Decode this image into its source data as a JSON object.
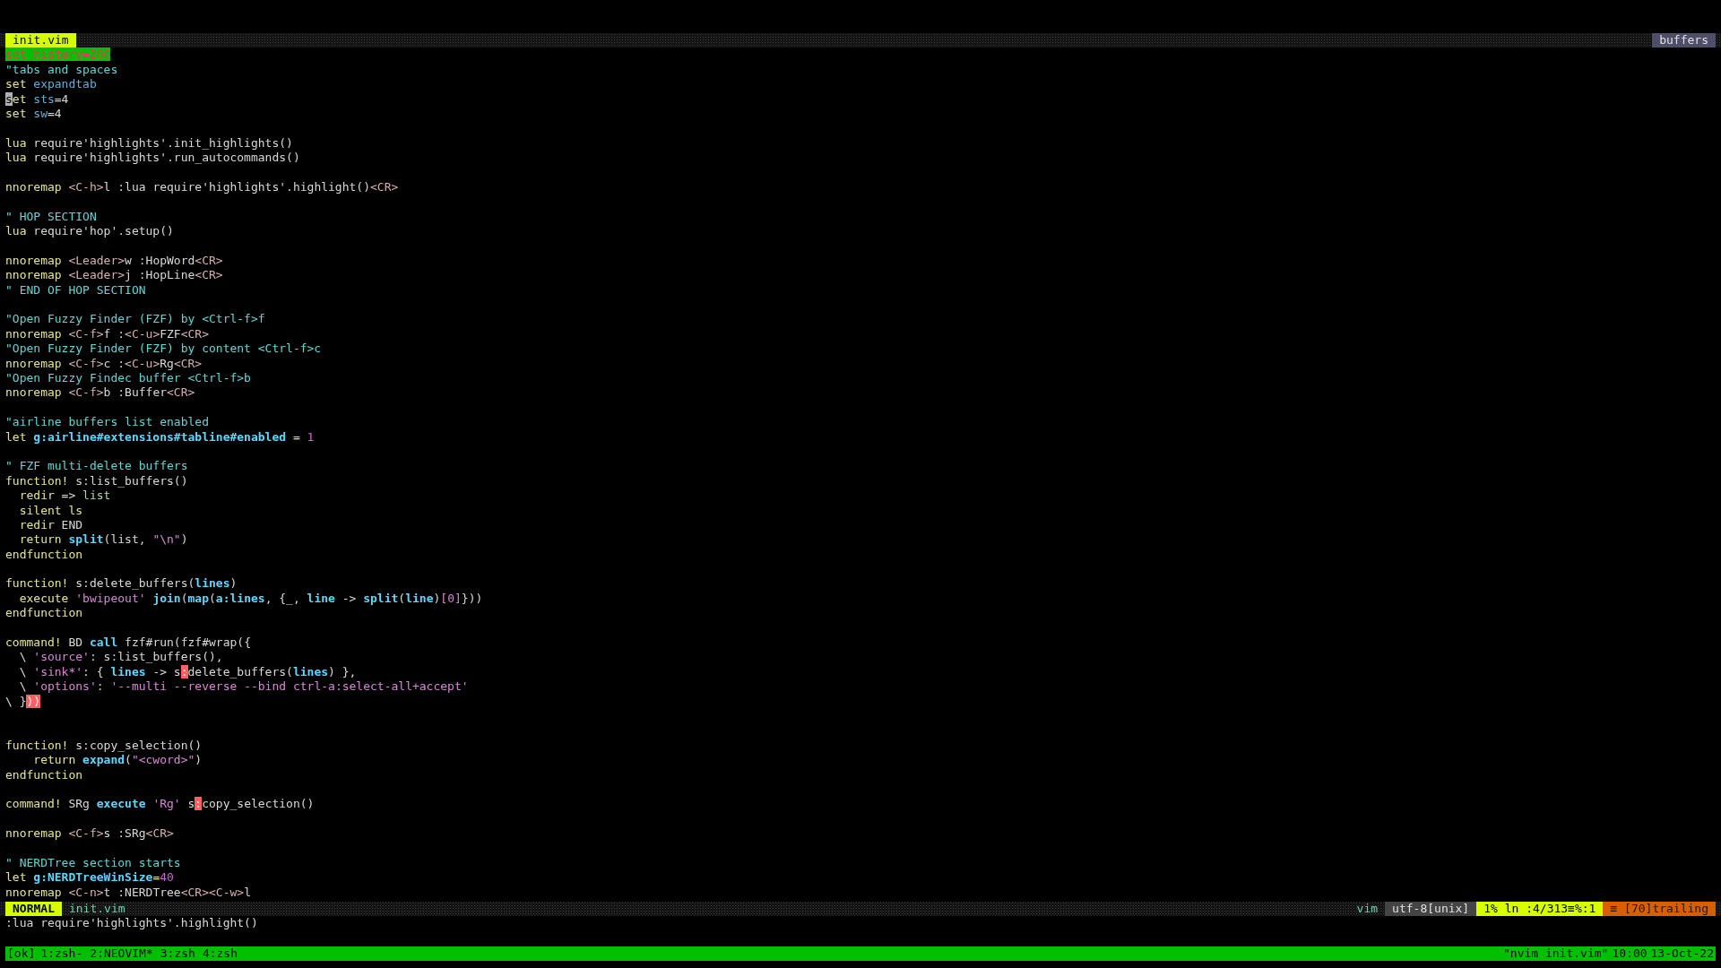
{
  "tabline": {
    "buffer": "init.vim",
    "label": "buffers"
  },
  "lines": [
    {
      "kind": "code",
      "segments": [
        {
          "kind": "hl",
          "text": "set history=200"
        }
      ]
    },
    {
      "kind": "code",
      "segments": [
        {
          "kind": "comment",
          "text": "\"tabs and spaces"
        }
      ]
    },
    {
      "kind": "code",
      "segments": [
        {
          "kind": "kw",
          "text": "set "
        },
        {
          "kind": "option",
          "text": "expandtab"
        }
      ]
    },
    {
      "kind": "code",
      "segments": [
        {
          "kind": "cursor",
          "text": "s"
        },
        {
          "kind": "kw",
          "text": "et "
        },
        {
          "kind": "option",
          "text": "sts"
        },
        {
          "kind": "plain",
          "text": "=4"
        }
      ]
    },
    {
      "kind": "code",
      "segments": [
        {
          "kind": "kw",
          "text": "set "
        },
        {
          "kind": "option",
          "text": "sw"
        },
        {
          "kind": "plain",
          "text": "=4"
        }
      ]
    },
    {
      "kind": "blank"
    },
    {
      "kind": "code",
      "segments": [
        {
          "kind": "kw",
          "text": "lua"
        },
        {
          "kind": "plain",
          "text": " require'highlights'.init_highlights()"
        }
      ]
    },
    {
      "kind": "code",
      "segments": [
        {
          "kind": "kw",
          "text": "lua"
        },
        {
          "kind": "plain",
          "text": " require'highlights'.run_autocommands()"
        }
      ]
    },
    {
      "kind": "blank"
    },
    {
      "kind": "code",
      "segments": [
        {
          "kind": "kw",
          "text": "nnoremap "
        },
        {
          "kind": "key",
          "text": "<C-h>"
        },
        {
          "kind": "plain",
          "text": "l :lua require'highlights'.highlight()"
        },
        {
          "kind": "key",
          "text": "<CR>"
        }
      ]
    },
    {
      "kind": "blank"
    },
    {
      "kind": "code",
      "segments": [
        {
          "kind": "comment",
          "text": "\" HOP SECTION"
        }
      ]
    },
    {
      "kind": "code",
      "segments": [
        {
          "kind": "kw",
          "text": "lua"
        },
        {
          "kind": "plain",
          "text": " require'hop'.setup()"
        }
      ]
    },
    {
      "kind": "blank"
    },
    {
      "kind": "code",
      "segments": [
        {
          "kind": "kw",
          "text": "nnoremap "
        },
        {
          "kind": "key",
          "text": "<Leader>"
        },
        {
          "kind": "plain",
          "text": "w :HopWord"
        },
        {
          "kind": "key",
          "text": "<CR>"
        }
      ]
    },
    {
      "kind": "code",
      "segments": [
        {
          "kind": "kw",
          "text": "nnoremap "
        },
        {
          "kind": "key",
          "text": "<Leader>"
        },
        {
          "kind": "plain",
          "text": "j :HopLine"
        },
        {
          "kind": "key",
          "text": "<CR>"
        }
      ]
    },
    {
      "kind": "code",
      "segments": [
        {
          "kind": "comment",
          "text": "\" END OF HOP SECTION"
        }
      ]
    },
    {
      "kind": "blank"
    },
    {
      "kind": "code",
      "segments": [
        {
          "kind": "comment",
          "text": "\"Open Fuzzy Finder (FZF) by <Ctrl-f>f"
        }
      ]
    },
    {
      "kind": "code",
      "segments": [
        {
          "kind": "kw",
          "text": "nnoremap "
        },
        {
          "kind": "key",
          "text": "<C-f>"
        },
        {
          "kind": "plain",
          "text": "f :"
        },
        {
          "kind": "key",
          "text": "<C-u>"
        },
        {
          "kind": "plain",
          "text": "FZF"
        },
        {
          "kind": "key",
          "text": "<CR>"
        }
      ]
    },
    {
      "kind": "code",
      "segments": [
        {
          "kind": "comment",
          "text": "\"Open Fuzzy Finder (FZF) by content <Ctrl-f>c"
        }
      ]
    },
    {
      "kind": "code",
      "segments": [
        {
          "kind": "kw",
          "text": "nnoremap "
        },
        {
          "kind": "key",
          "text": "<C-f>"
        },
        {
          "kind": "plain",
          "text": "c :"
        },
        {
          "kind": "key",
          "text": "<C-u>"
        },
        {
          "kind": "plain",
          "text": "Rg"
        },
        {
          "kind": "key",
          "text": "<CR>"
        }
      ]
    },
    {
      "kind": "code",
      "segments": [
        {
          "kind": "comment",
          "text": "\"Open Fuzzy Findec buffer <Ctrl-f>b"
        }
      ]
    },
    {
      "kind": "code",
      "segments": [
        {
          "kind": "kw",
          "text": "nnoremap "
        },
        {
          "kind": "key",
          "text": "<C-f>"
        },
        {
          "kind": "plain",
          "text": "b :Buffer"
        },
        {
          "kind": "key",
          "text": "<CR>"
        }
      ]
    },
    {
      "kind": "blank"
    },
    {
      "kind": "code",
      "segments": [
        {
          "kind": "comment",
          "text": "\"airline buffers list enabled"
        }
      ]
    },
    {
      "kind": "code",
      "segments": [
        {
          "kind": "kw",
          "text": "let "
        },
        {
          "kind": "var",
          "text": "g:airline#extensions#tabline#enabled"
        },
        {
          "kind": "kw",
          "text": " = "
        },
        {
          "kind": "num",
          "text": "1"
        }
      ]
    },
    {
      "kind": "blank"
    },
    {
      "kind": "code",
      "segments": [
        {
          "kind": "comment",
          "text": "\" FZF multi-delete buffers"
        }
      ]
    },
    {
      "kind": "code",
      "segments": [
        {
          "kind": "kw",
          "text": "function!"
        },
        {
          "kind": "plain",
          "text": " s:list_buffers()"
        }
      ]
    },
    {
      "kind": "code",
      "segments": [
        {
          "kind": "kw",
          "text": "  redir"
        },
        {
          "kind": "plain",
          "text": " => "
        },
        {
          "kind": "list",
          "text": "list"
        }
      ]
    },
    {
      "kind": "code",
      "segments": [
        {
          "kind": "kw",
          "text": "  silent ls"
        }
      ]
    },
    {
      "kind": "code",
      "segments": [
        {
          "kind": "kw",
          "text": "  redir"
        },
        {
          "kind": "plain",
          "text": " END"
        }
      ]
    },
    {
      "kind": "code",
      "segments": [
        {
          "kind": "kw",
          "text": "  return "
        },
        {
          "kind": "func",
          "text": "split"
        },
        {
          "kind": "plain",
          "text": "(list, "
        },
        {
          "kind": "str",
          "text": "\"\\n\""
        },
        {
          "kind": "plain",
          "text": ")"
        }
      ]
    },
    {
      "kind": "code",
      "segments": [
        {
          "kind": "kw",
          "text": "endfunction"
        }
      ]
    },
    {
      "kind": "blank"
    },
    {
      "kind": "code",
      "segments": [
        {
          "kind": "kw",
          "text": "function!"
        },
        {
          "kind": "plain",
          "text": " s:delete_buffers("
        },
        {
          "kind": "func",
          "text": "lines"
        },
        {
          "kind": "plain",
          "text": ")"
        }
      ]
    },
    {
      "kind": "code",
      "segments": [
        {
          "kind": "kw",
          "text": "  execute "
        },
        {
          "kind": "str",
          "text": "'bwipeout' "
        },
        {
          "kind": "func",
          "text": "join"
        },
        {
          "kind": "plain",
          "text": "("
        },
        {
          "kind": "func",
          "text": "map"
        },
        {
          "kind": "plain",
          "text": "("
        },
        {
          "kind": "func",
          "text": "a:lines"
        },
        {
          "kind": "plain",
          "text": ", {_, "
        },
        {
          "kind": "func",
          "text": "line"
        },
        {
          "kind": "plain",
          "text": " -> "
        },
        {
          "kind": "func",
          "text": "split"
        },
        {
          "kind": "plain",
          "text": "("
        },
        {
          "kind": "func",
          "text": "line"
        },
        {
          "kind": "plain",
          "text": ")"
        },
        {
          "kind": "str",
          "text": "[0]"
        },
        {
          "kind": "plain",
          "text": "}))"
        }
      ]
    },
    {
      "kind": "code",
      "segments": [
        {
          "kind": "kw",
          "text": "endfunction"
        }
      ]
    },
    {
      "kind": "blank"
    },
    {
      "kind": "code",
      "segments": [
        {
          "kind": "kw",
          "text": "command!"
        },
        {
          "kind": "plain",
          "text": " BD "
        },
        {
          "kind": "func",
          "text": "call"
        },
        {
          "kind": "plain",
          "text": " fzf#run(fzf#wrap({"
        }
      ]
    },
    {
      "kind": "code",
      "segments": [
        {
          "kind": "plain",
          "text": "  \\ "
        },
        {
          "kind": "str",
          "text": "'source'"
        },
        {
          "kind": "plain",
          "text": ": s:list_buffers(),"
        }
      ]
    },
    {
      "kind": "code",
      "segments": [
        {
          "kind": "plain",
          "text": "  \\ "
        },
        {
          "kind": "str",
          "text": "'sink*'"
        },
        {
          "kind": "plain",
          "text": ": { "
        },
        {
          "kind": "func",
          "text": "lines"
        },
        {
          "kind": "plain",
          "text": " -> s"
        },
        {
          "kind": "match",
          "text": ":"
        },
        {
          "kind": "plain",
          "text": "delete_buffers("
        },
        {
          "kind": "func",
          "text": "lines"
        },
        {
          "kind": "plain",
          "text": ") },"
        }
      ]
    },
    {
      "kind": "code",
      "segments": [
        {
          "kind": "plain",
          "text": "  \\ "
        },
        {
          "kind": "str",
          "text": "'options'"
        },
        {
          "kind": "plain",
          "text": ": "
        },
        {
          "kind": "str",
          "text": "'--multi --reverse --bind ctrl-a:select-all+accept'"
        }
      ]
    },
    {
      "kind": "code",
      "segments": [
        {
          "kind": "plain",
          "text": "\\ }"
        },
        {
          "kind": "match",
          "text": "))"
        }
      ]
    },
    {
      "kind": "blank"
    },
    {
      "kind": "blank"
    },
    {
      "kind": "code",
      "segments": [
        {
          "kind": "kw",
          "text": "function!"
        },
        {
          "kind": "plain",
          "text": " s:copy_selection()"
        }
      ]
    },
    {
      "kind": "code",
      "segments": [
        {
          "kind": "kw",
          "text": "    return "
        },
        {
          "kind": "func",
          "text": "expand"
        },
        {
          "kind": "plain",
          "text": "("
        },
        {
          "kind": "str",
          "text": "\"<cword>\""
        },
        {
          "kind": "plain",
          "text": ")"
        }
      ]
    },
    {
      "kind": "code",
      "segments": [
        {
          "kind": "kw",
          "text": "endfunction"
        }
      ]
    },
    {
      "kind": "blank"
    },
    {
      "kind": "code",
      "segments": [
        {
          "kind": "kw",
          "text": "command!"
        },
        {
          "kind": "plain",
          "text": " SRg "
        },
        {
          "kind": "func",
          "text": "execute"
        },
        {
          "kind": "str",
          "text": " 'Rg'"
        },
        {
          "kind": "plain",
          "text": " s"
        },
        {
          "kind": "match",
          "text": ":"
        },
        {
          "kind": "plain",
          "text": "copy_selection()"
        }
      ]
    },
    {
      "kind": "blank"
    },
    {
      "kind": "code",
      "segments": [
        {
          "kind": "kw",
          "text": "nnoremap "
        },
        {
          "kind": "key",
          "text": "<C-f>"
        },
        {
          "kind": "plain",
          "text": "s :SRg"
        },
        {
          "kind": "key",
          "text": "<CR>"
        }
      ]
    },
    {
      "kind": "blank"
    },
    {
      "kind": "code",
      "segments": [
        {
          "kind": "comment",
          "text": "\" NERDTree section starts"
        }
      ]
    },
    {
      "kind": "code",
      "segments": [
        {
          "kind": "kw",
          "text": "let "
        },
        {
          "kind": "var",
          "text": "g:NERDTreeWinSize"
        },
        {
          "kind": "kw",
          "text": "="
        },
        {
          "kind": "num",
          "text": "40"
        }
      ]
    },
    {
      "kind": "code",
      "segments": [
        {
          "kind": "kw",
          "text": "nnoremap "
        },
        {
          "kind": "key",
          "text": "<C-n>"
        },
        {
          "kind": "plain",
          "text": "t :NERDTree"
        },
        {
          "kind": "key",
          "text": "<CR><C-w>"
        },
        {
          "kind": "plain",
          "text": "l"
        }
      ]
    }
  ],
  "status_line": {
    "mode": "NORMAL",
    "file": "init.vim",
    "filetype": "vim",
    "encoding": "utf-8[unix]",
    "position": "1% ln :4/313≡%:1",
    "warning": "≡ [70]trailing"
  },
  "command_line": ":lua require'highlights'.highlight()",
  "tmux_bar": {
    "session_status": "[ok]",
    "windows": [
      "1:zsh-",
      "2:NEOVIM*",
      "3:zsh",
      "4:zsh"
    ],
    "title": "\"nvim init.vim\"",
    "time": "10:00",
    "date": "13-Oct-22"
  }
}
